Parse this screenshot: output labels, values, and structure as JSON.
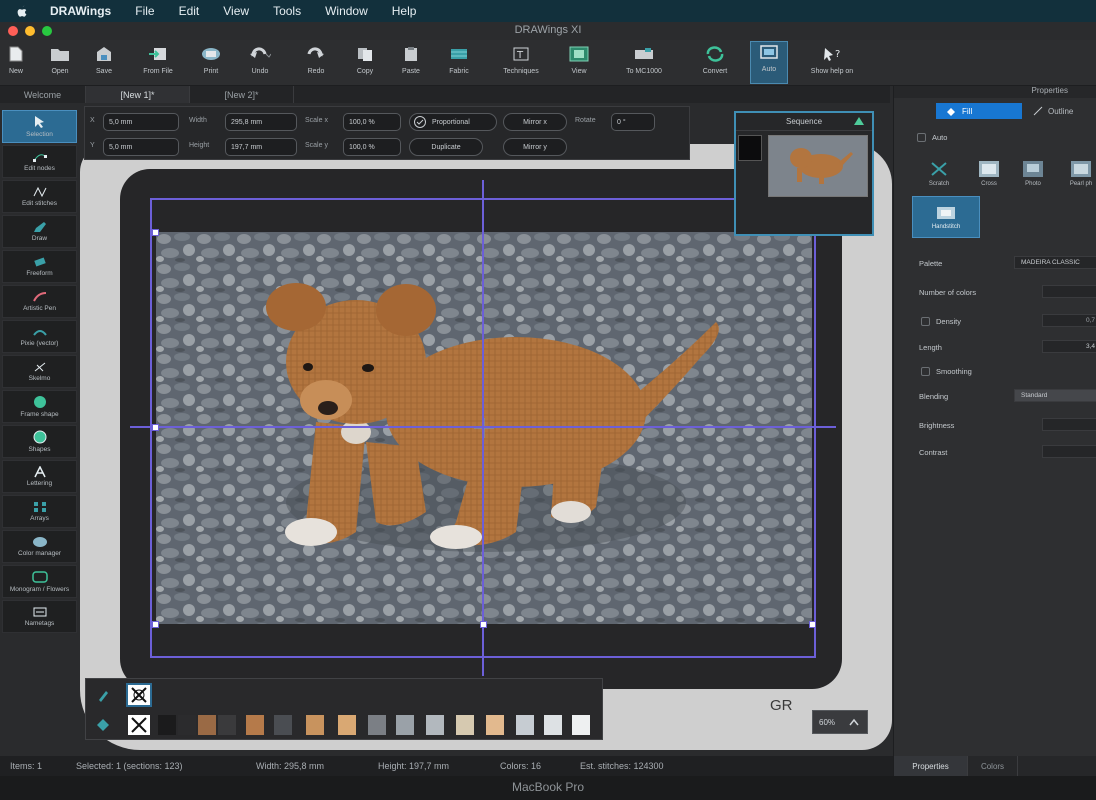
{
  "menubar": {
    "app_name": "DRAWings",
    "items": [
      "File",
      "Edit",
      "View",
      "Tools",
      "Window",
      "Help"
    ]
  },
  "window": {
    "title": "DRAWings XI"
  },
  "toolbar": {
    "new": "New",
    "open": "Open",
    "save": "Save",
    "from_file": "From File",
    "print": "Print",
    "undo": "Undo",
    "redo": "Redo",
    "copy": "Copy",
    "paste": "Paste",
    "fabric": "Fabric",
    "techniques": "Techniques",
    "view": "View",
    "machine": "To MC1000",
    "convert": "Convert",
    "auto": "Auto",
    "show_help": "Show help on"
  },
  "doc_tabs": {
    "welcome": "Welcome",
    "new1": "[New 1]*",
    "new2": "[New 2]*"
  },
  "tools": [
    "Selection",
    "Edit nodes",
    "Edit stitches",
    "Draw",
    "Freeform",
    "Artistic Pen",
    "Pixie (vector)",
    "Skelmo",
    "Frame shape",
    "Shapes",
    "Lettering",
    "Arrays",
    "Color manager",
    "Monogram / Flowers",
    "Nametags"
  ],
  "transform": {
    "x_value": "5,0 mm",
    "y_value": "5,0 mm",
    "width_label": "Width",
    "width_value": "295,8 mm",
    "height_label": "Height",
    "height_value": "197,7 mm",
    "scale_x_label": "Scale x",
    "scale_x_value": "100,0 %",
    "scale_y_label": "Scale y",
    "scale_y_value": "100,0 %",
    "proportional": "Proportional",
    "duplicate": "Duplicate",
    "mirror_x": "Mirror x",
    "mirror_y": "Mirror y",
    "rotate_label": "Rotate",
    "rotate_value": "0 °"
  },
  "sequence": {
    "title": "Sequence"
  },
  "zoom": {
    "value": "60%"
  },
  "watermark": "GR",
  "palette": {
    "colors": [
      "#1b1b1c",
      "#2b2b2d",
      "#9a6a45",
      "#3a3a3c",
      "#b57a4a",
      "#4a4d52",
      "#c8935e",
      "#d9a873",
      "#7b7f85",
      "#9aa1a8",
      "#b2b8be",
      "#d6c9b0",
      "#e2b98e",
      "#c6ccd2",
      "#dde1e4",
      "#eef0f1"
    ]
  },
  "properties": {
    "title": "Properties",
    "tab_fill": "Fill",
    "tab_outline": "Outline",
    "auto_label": "Auto",
    "stitch_types": [
      "Scratch",
      "Cross",
      "Photo",
      "Pearl ph"
    ],
    "handstitch": "Handstitch",
    "palette_label": "Palette",
    "palette_value": "MADEIRA CLASSIC",
    "num_colors_label": "Number of colors",
    "num_colors_value": "",
    "density_label": "Density",
    "density_value": "0,7",
    "length_label": "Length",
    "length_value": "3,4",
    "smoothing_label": "Smoothing",
    "blending_label": "Blending",
    "blending_value": "Standard",
    "brightness_label": "Brightness",
    "contrast_label": "Contrast",
    "bottom_tabs": [
      "Properties",
      "Colors"
    ]
  },
  "status": {
    "items": "Items: 1",
    "selected": "Selected: 1 (sections: 123)",
    "width": "Width: 295,8 mm",
    "height": "Height: 197,7 mm",
    "colors": "Colors: 16",
    "stitches": "Est. stitches: 124300"
  },
  "device": {
    "label": "MacBook Pro"
  }
}
